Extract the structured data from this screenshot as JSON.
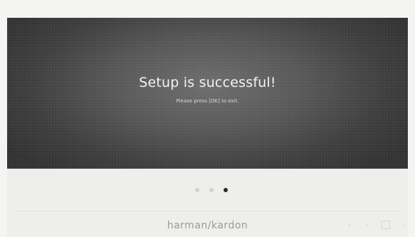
{
  "dialog": {
    "title": "Setup is successful!",
    "message": "Please press [OK] to exit."
  },
  "pager": {
    "page_count": 3,
    "current_page": 3
  },
  "footer": {
    "brand": "harman/kardon"
  },
  "controls": {
    "icons": [
      "chevron-left-icon",
      "chevron-right-icon",
      "square-icon",
      "minus-icon"
    ]
  },
  "colors": {
    "screen_bg": "#4a4a4a",
    "panel_bg": "#eeeeec",
    "active_dot": "#2a2a2a",
    "inactive_dot": "#d2d2d0"
  }
}
